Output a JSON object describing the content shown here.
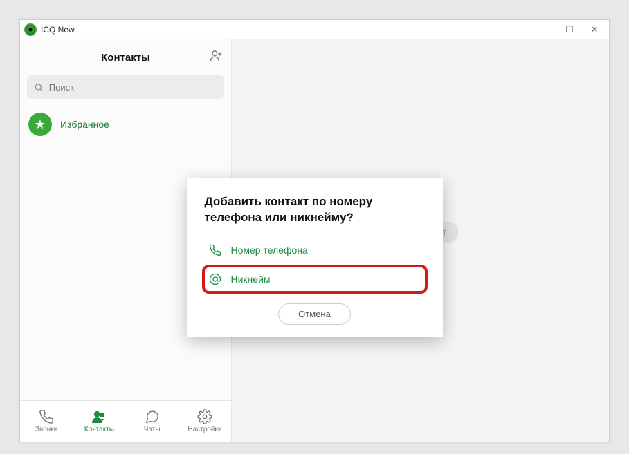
{
  "window": {
    "title": "ICQ New"
  },
  "sidebar": {
    "title": "Контакты",
    "search_placeholder": "Поиск",
    "favorites_label": "Избранное"
  },
  "nav": {
    "items": [
      {
        "id": "calls",
        "label": "Звонки"
      },
      {
        "id": "contacts",
        "label": "Контакты"
      },
      {
        "id": "chats",
        "label": "Чаты"
      },
      {
        "id": "settings",
        "label": "Настройки"
      }
    ],
    "active_index": 1
  },
  "main": {
    "placeholder_pill": "ыберите чат"
  },
  "dialog": {
    "title": "Добавить контакт по номеру телефона или никнейму?",
    "option_phone": "Номер телефона",
    "option_nickname": "Никнейм",
    "cancel": "Отмена",
    "highlighted_option": "nickname"
  },
  "colors": {
    "accent": "#1c8d40",
    "highlight_border": "#d11a1a"
  }
}
